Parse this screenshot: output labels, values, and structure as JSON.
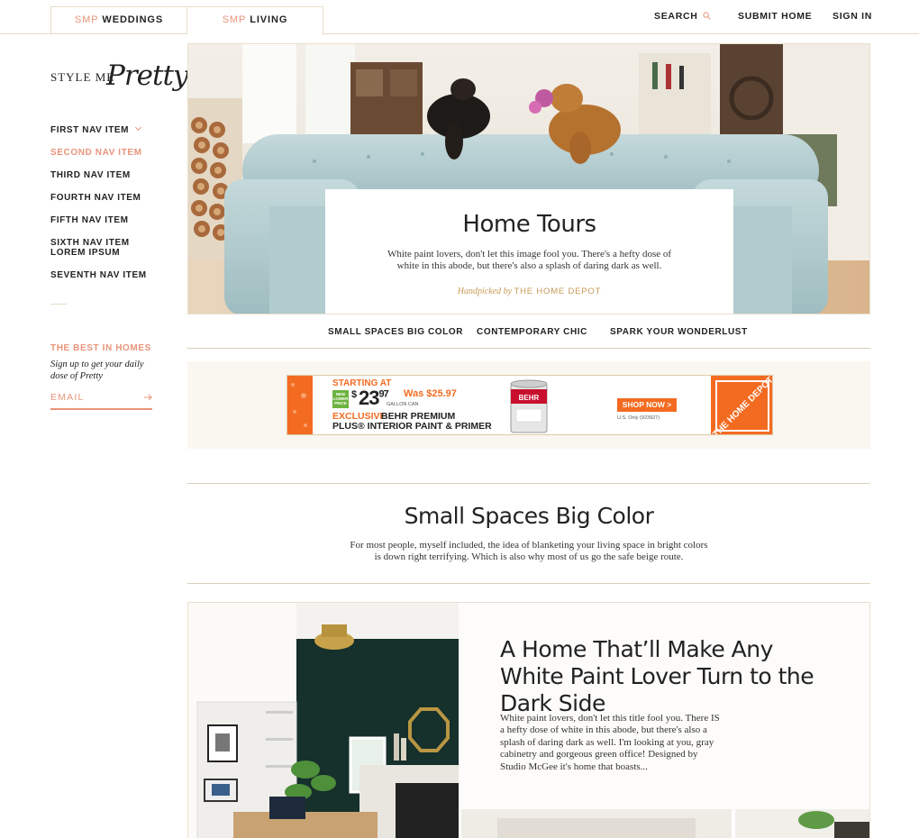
{
  "header": {
    "tabs": [
      {
        "prefix": "SMP",
        "label": "WEDDINGS"
      },
      {
        "prefix": "SMP",
        "label": "LIVING"
      }
    ],
    "search_label": "SEARCH",
    "submit_label": "SUBMIT HOME",
    "signin_label": "SIGN IN"
  },
  "logo": {
    "small": "STYLE ME",
    "script": "Pretty"
  },
  "sidebar": {
    "nav": [
      {
        "label": "FIRST NAV ITEM"
      },
      {
        "label": "SECOND NAV ITEM"
      },
      {
        "label": "THIRD NAV ITEM"
      },
      {
        "label": "FOURTH NAV ITEM"
      },
      {
        "label": "FIFTH NAV ITEM"
      },
      {
        "label": "SIXTH NAV ITEM"
      },
      {
        "label": "LOREM IPSUM"
      },
      {
        "label": "SEVENTH NAV ITEM"
      }
    ],
    "best_title": "THE BEST IN HOMES",
    "best_subtitle": "Sign up to get your daily dose of Pretty",
    "email_placeholder": "EMAIL"
  },
  "hero": {
    "title": "Home Tours",
    "description": "White paint lovers, don't let this image fool you. There's a hefty dose of white in this abode, but there's also a splash of daring dark as well.",
    "handpicked_prefix": "Handpicked by",
    "sponsor": "THE HOME DEPOT"
  },
  "subtabs": [
    "SMALL SPACES BIG COLOR",
    "CONTEMPORARY CHIC",
    "SPARK YOUR WONDERLUST"
  ],
  "ad": {
    "starting": "STARTING AT",
    "badge": "NEW LOWER PRICE",
    "dollar": "$",
    "price": "23",
    "cents": "97",
    "was": "Was $25.97",
    "unit": "GALLON CAN",
    "exclusive": "EXCLUSIVE",
    "brand": "BEHR PREMIUM",
    "line2": "PLUS® INTERIOR PAINT & PRIMER",
    "can_label": "BEHR",
    "cta": "SHOP NOW >",
    "only": "U.S. Only (923927)",
    "logo_text": "THE HOME DEPOT"
  },
  "section": {
    "title": "Small Spaces Big Color",
    "description": "For most people, myself included, the idea of blanketing your living space in bright colors is down right terrifying. Which is also why most of us go the safe beige route."
  },
  "article": {
    "title": "A Home That’ll Make Any White Paint Lover Turn to the Dark Side",
    "excerpt": "White paint lovers, don't let this title fool you. There IS a hefty dose of white in this abode, but there's also a splash of daring dark as well. I'm looking at you, gray cabinetry and gorgeous green office! Designed by Studio McGee it's home that boasts..."
  },
  "colors": {
    "accent": "#e8947a",
    "gold": "#c99a55",
    "rule": "#d9cfbc",
    "ad_orange": "#f36b21"
  }
}
